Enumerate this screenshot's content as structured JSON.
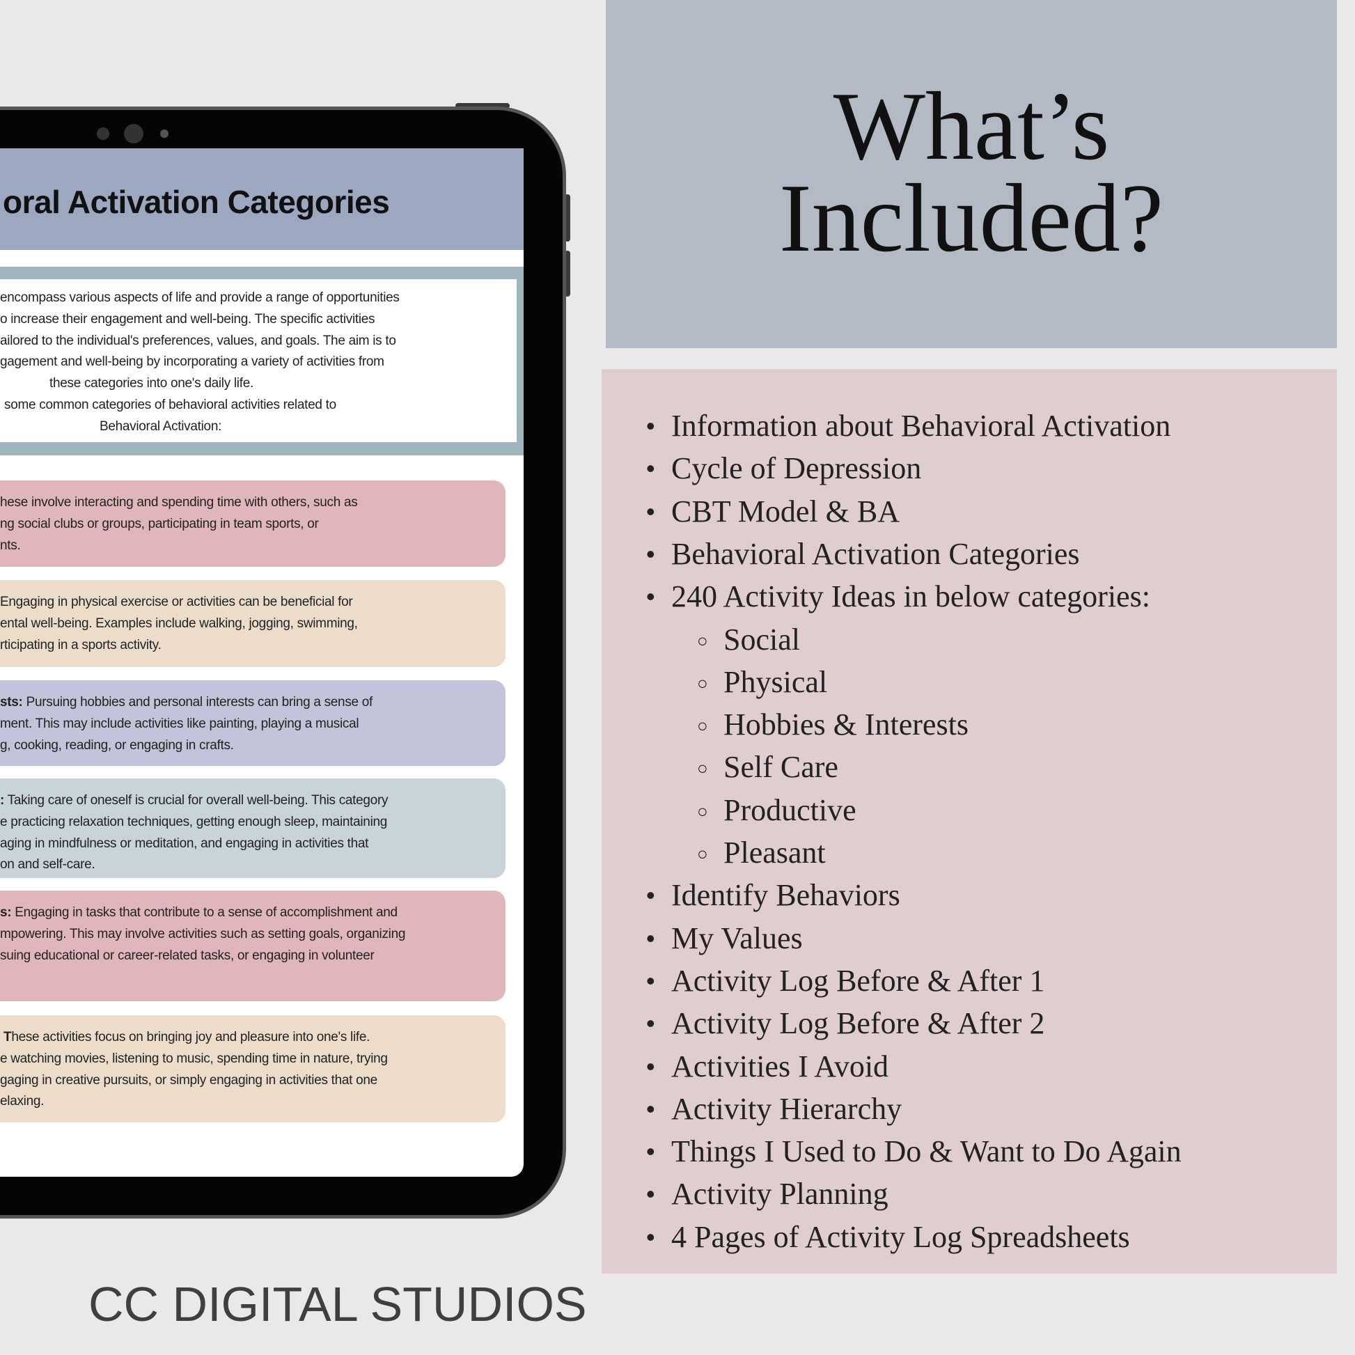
{
  "colors": {
    "top_box": "#b3bac6",
    "list_box": "#e0cdd0",
    "header": "#9ca7c0",
    "intro_frame": "#a0b4be",
    "social": "#e0b5bb",
    "physical": "#eedccb",
    "hobbies": "#c3c3d9",
    "self_care": "#c8d3da",
    "productive": "#e0b5bb",
    "pleasant": "#eedccb"
  },
  "heading": {
    "line1": "What’s",
    "line2": "Included?"
  },
  "list": [
    {
      "text": "Information about Behavioral Activation",
      "level": 1
    },
    {
      "text": "Cycle of Depression",
      "level": 1
    },
    {
      "text": "CBT Model & BA",
      "level": 1
    },
    {
      "text": "Behavioral Activation Categories",
      "level": 1
    },
    {
      "text": "240 Activity Ideas in below categories:",
      "level": 1
    },
    {
      "text": "Social",
      "level": 2
    },
    {
      "text": "Physical",
      "level": 2
    },
    {
      "text": "Hobbies & Interests",
      "level": 2
    },
    {
      "text": "Self Care",
      "level": 2
    },
    {
      "text": "Productive",
      "level": 2
    },
    {
      "text": "Pleasant",
      "level": 2
    },
    {
      "text": "Identify Behaviors",
      "level": 1
    },
    {
      "text": "My Values",
      "level": 1
    },
    {
      "text": "Activity Log Before & After 1",
      "level": 1
    },
    {
      "text": "Activity Log Before & After 2",
      "level": 1
    },
    {
      "text": "Activities I Avoid",
      "level": 1
    },
    {
      "text": "Activity Hierarchy",
      "level": 1
    },
    {
      "text": "Things I Used to Do & Want to Do Again",
      "level": 1
    },
    {
      "text": "Activity Planning",
      "level": 1
    },
    {
      "text": "4 Pages of Activity Log Spreadsheets",
      "level": 1
    }
  ],
  "tablet": {
    "title": "oral Activation Categories",
    "intro": [
      "encompass various aspects of life and provide a range of opportunities",
      "o increase their engagement and well-being.  The specific activities",
      "ailored to the individual's preferences, values, and goals. The aim is to",
      "gagement and well-being by incorporating a variety of activities from",
      "these categories into one's daily life.",
      " some common categories of behavioral activities related to",
      "Behavioral Activation:"
    ],
    "cards": [
      {
        "lines": [
          {
            "b": "",
            "t": "hese involve interacting and spending time with others, such as"
          },
          {
            "b": "",
            "t": "ng social clubs or groups, participating in team sports, or"
          },
          {
            "b": "",
            "t": "nts."
          }
        ]
      },
      {
        "lines": [
          {
            "b": "",
            "t": "Engaging in physical exercise or activities can be beneficial for"
          },
          {
            "b": "",
            "t": "ental well-being. Examples include walking, jogging, swimming,"
          },
          {
            "b": "",
            "t": "rticipating in a sports activity."
          }
        ]
      },
      {
        "lines": [
          {
            "b": "sts:",
            "t": " Pursuing hobbies and personal interests can bring a sense of"
          },
          {
            "b": "",
            "t": "ment. This may include activities like painting, playing a musical"
          },
          {
            "b": "",
            "t": "g, cooking, reading, or engaging in crafts."
          }
        ]
      },
      {
        "lines": [
          {
            "b": ":",
            "t": " Taking care of oneself is crucial for overall well-being. This category"
          },
          {
            "b": "",
            "t": "e practicing relaxation techniques, getting enough sleep, maintaining"
          },
          {
            "b": "",
            "t": "aging in mindfulness or meditation, and engaging in activities that"
          },
          {
            "b": "",
            "t": "on and self-care."
          }
        ]
      },
      {
        "lines": [
          {
            "b": "s:",
            "t": " Engaging in tasks that contribute to a sense of accomplishment and"
          },
          {
            "b": "",
            "t": "mpowering. This may involve activities such as setting goals, organizing"
          },
          {
            "b": "",
            "t": "suing educational or career-related tasks, or engaging in volunteer"
          }
        ]
      },
      {
        "lines": [
          {
            "b": "T",
            "t": "hese activities focus on bringing joy and pleasure into one's life."
          },
          {
            "b": "",
            "t": "e watching movies, listening to music, spending time in nature, trying"
          },
          {
            "b": "",
            "t": "gaging in creative pursuits, or simply engaging in activities that one"
          },
          {
            "b": "",
            "t": "elaxing."
          }
        ]
      }
    ]
  },
  "brand": "CC DIGITAL STUDIOS"
}
